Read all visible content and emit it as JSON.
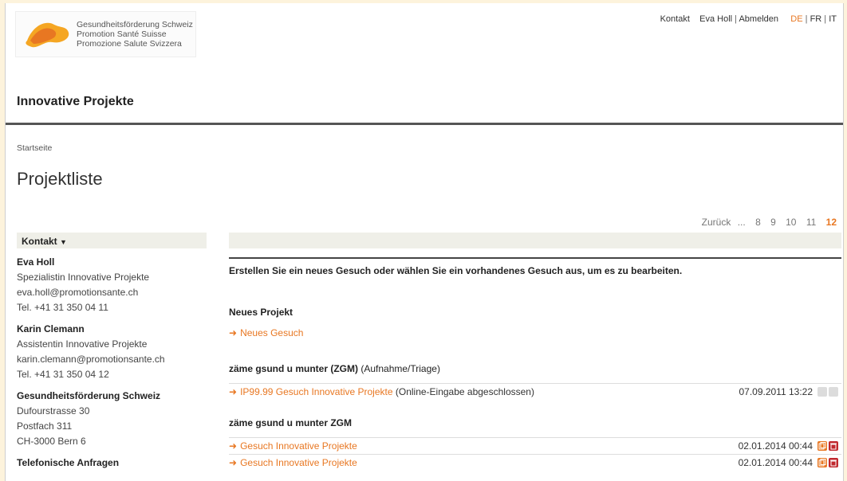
{
  "logo": {
    "line1": "Gesundheitsförderung Schweiz",
    "line2": "Promotion Santé Suisse",
    "line3": "Promozione Salute Svizzera"
  },
  "top_links": {
    "contact": "Kontakt",
    "user": "Eva Holl",
    "logout": "Abmelden",
    "lang_de": "DE",
    "lang_fr": "FR",
    "lang_it": "IT"
  },
  "app_title": "Innovative Projekte",
  "breadcrumb": "Startseite",
  "page_title": "Projektliste",
  "pager": {
    "back": "Zurück",
    "ellipsis": "...",
    "pages": [
      "8",
      "9",
      "10",
      "11"
    ],
    "current": "12"
  },
  "contact": {
    "header": "Kontakt",
    "people": [
      {
        "name": "Eva Holl",
        "role": "Spezialistin Innovative Projekte",
        "email": "eva.holl@promotionsante.ch",
        "phone": "Tel. +41 31 350 04 11"
      },
      {
        "name": "Karin Clemann",
        "role": "Assistentin Innovative Projekte",
        "email": "karin.clemann@promotionsante.ch",
        "phone": "Tel. +41 31 350 04 12"
      }
    ],
    "org": {
      "name": "Gesundheitsförderung Schweiz",
      "street": "Dufourstrasse 30",
      "box": "Postfach 311",
      "city": "CH-3000 Bern 6"
    },
    "phone_inquiries": "Telefonische Anfragen"
  },
  "main": {
    "intro": "Erstellen Sie ein neues Gesuch oder wählen Sie ein vorhandenes Gesuch aus, um es zu bearbeiten.",
    "new_project_title": "Neues Projekt",
    "new_request_link": "Neues Gesuch",
    "group1": {
      "title": "zäme gsund u munter (ZGM)",
      "subtitle": "(Aufnahme/Triage)",
      "rows": [
        {
          "link": "IP99.99 Gesuch Innovative Projekte",
          "status": "(Online-Eingabe abgeschlossen)",
          "date": "07.09.2011 13:22"
        }
      ]
    },
    "group2": {
      "title": "zäme gsund u munter ZGM",
      "rows": [
        {
          "link": "Gesuch Innovative Projekte",
          "date": "02.01.2014 00:44"
        },
        {
          "link": "Gesuch Innovative Projekte",
          "date": "02.01.2014 00:44"
        }
      ]
    }
  },
  "colors": {
    "accent": "#e87722",
    "delete": "#c0282e",
    "bar": "#efefe8"
  }
}
